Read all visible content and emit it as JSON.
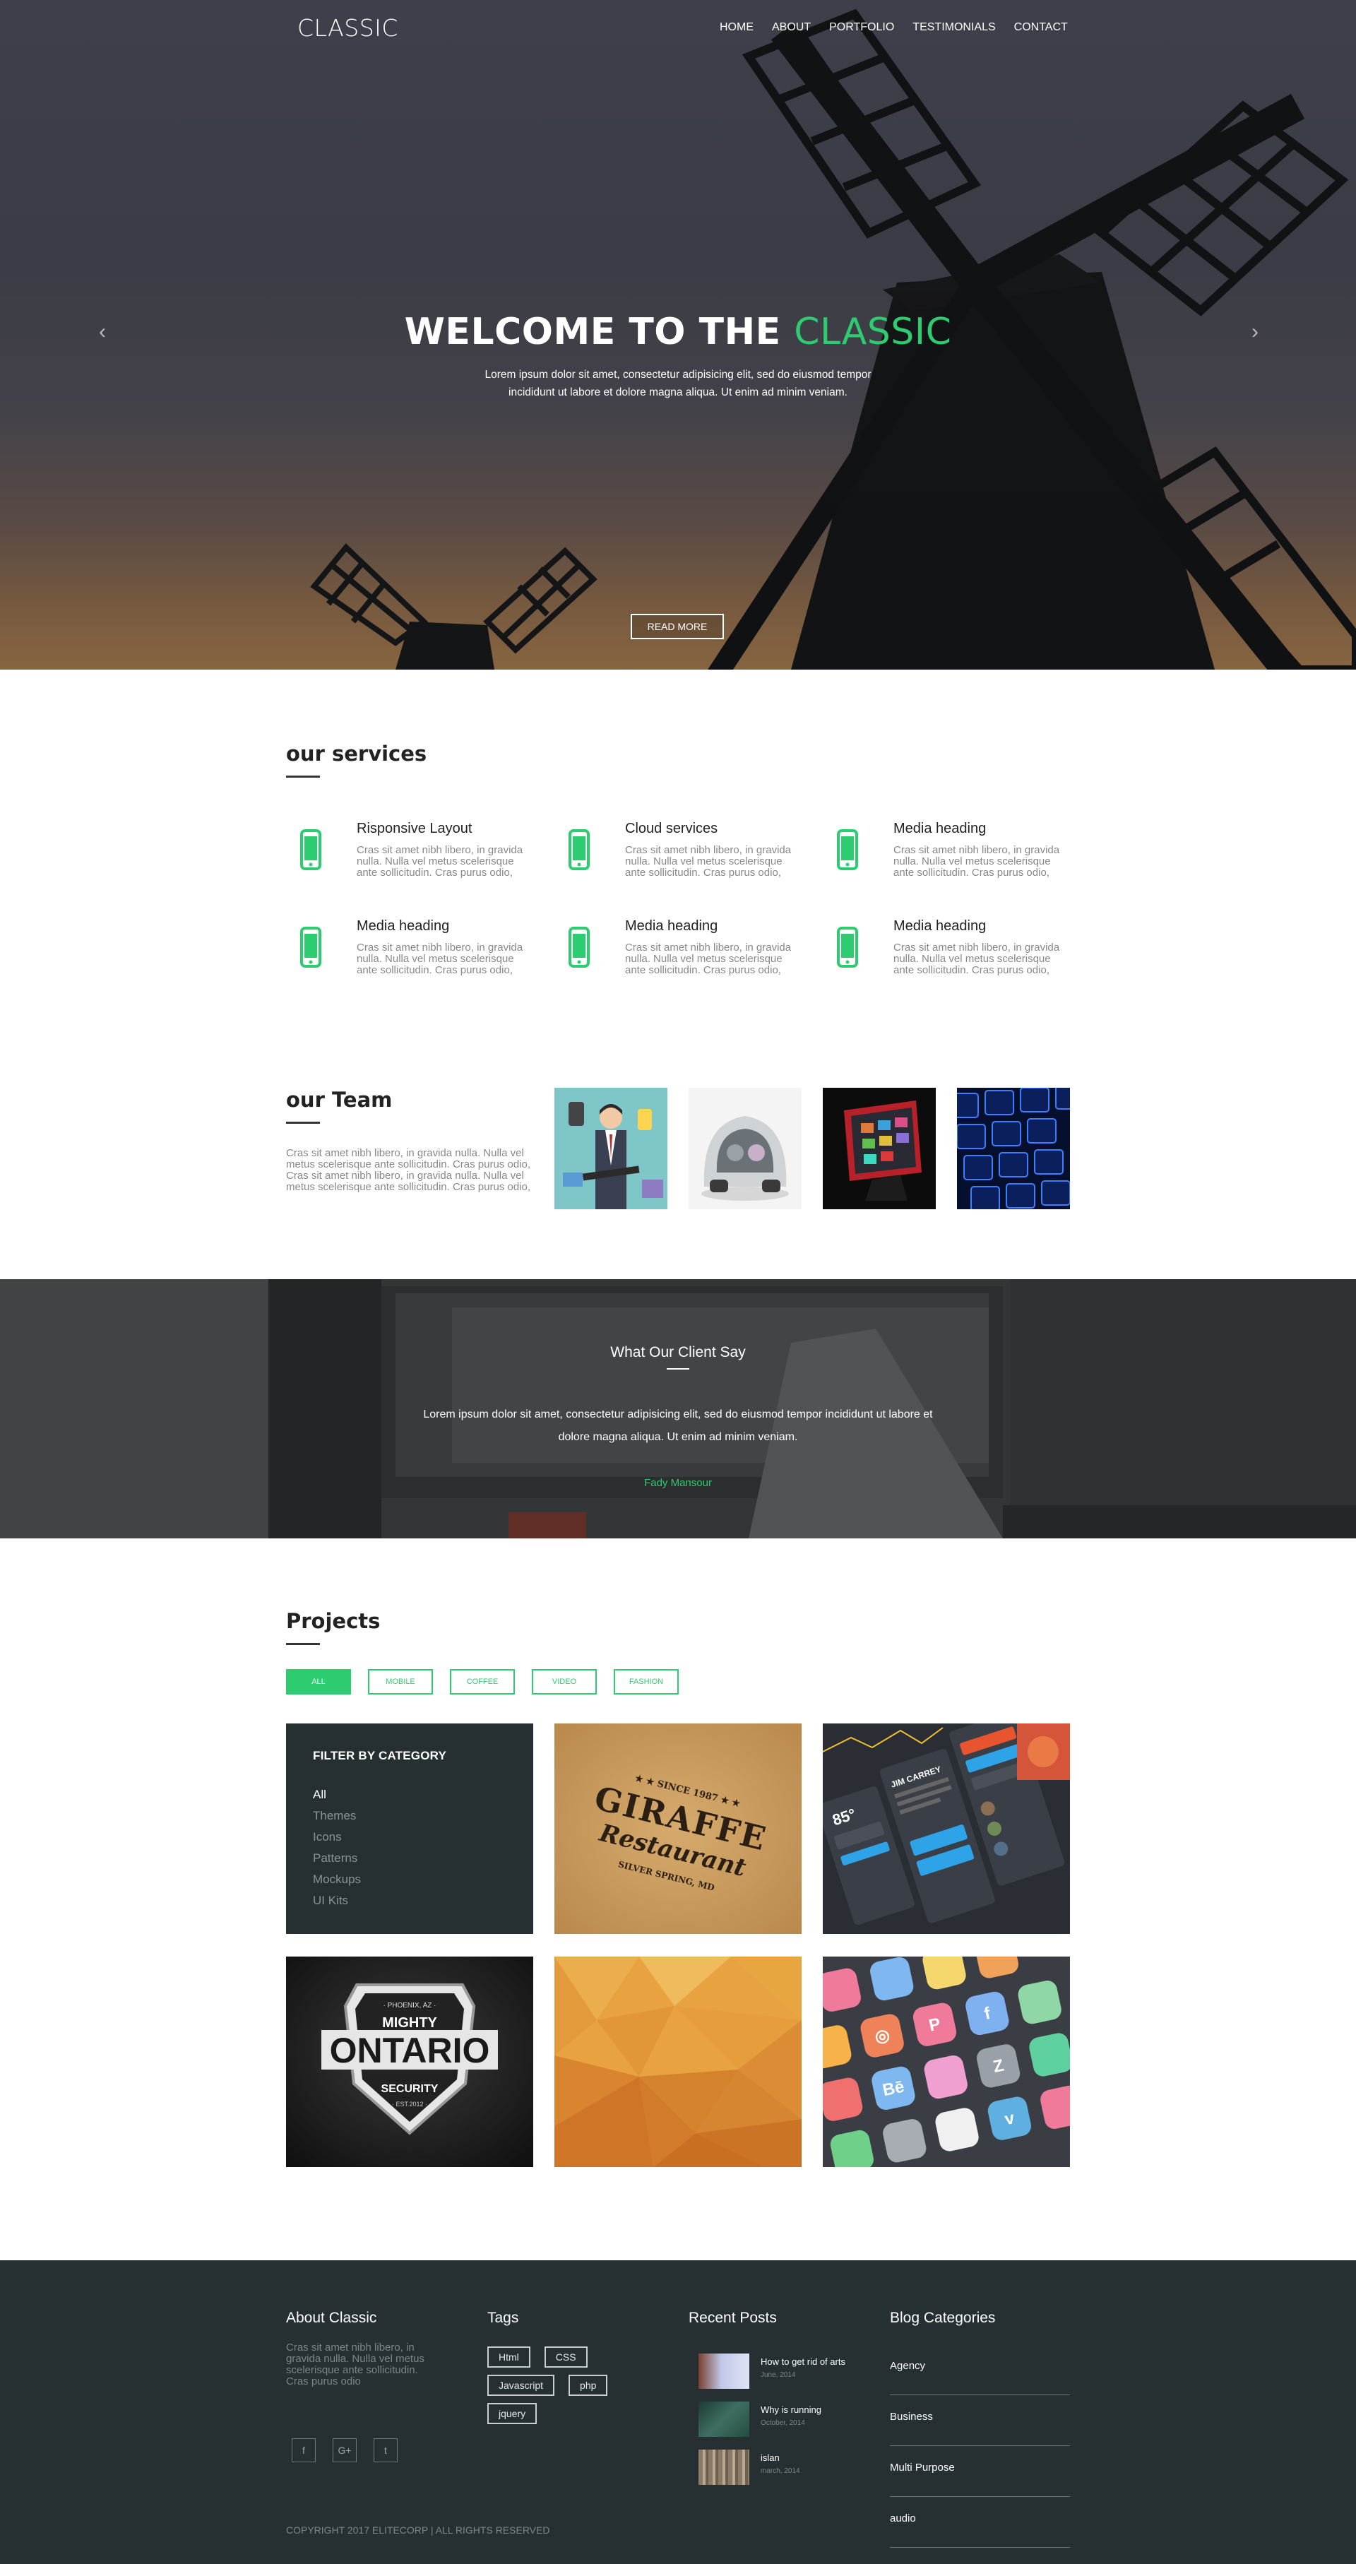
{
  "nav": {
    "logo": "CLASSIC",
    "items": [
      "HOME",
      "ABOUT",
      "PORTFOLIO",
      "TESTIMONIALS",
      "CONTACT"
    ]
  },
  "hero": {
    "title_main": "WELCOME TO THE ",
    "title_accent": "CLASSIC",
    "text": "Lorem ipsum dolor sit amet, consectetur adipisicing elit, sed do eiusmod tempor incididunt ut labore et dolore magna aliqua. Ut enim ad minim veniam.",
    "button": "READ MORE",
    "prev_icon": "chevron-left-icon",
    "next_icon": "chevron-right-icon"
  },
  "services": {
    "title": "our services",
    "items": [
      {
        "title": "Risponsive Layout",
        "text": "Cras sit amet nibh libero, in gravida nulla. Nulla vel metus scelerisque ante sollicitudin. Cras purus odio,",
        "icon": "mobile-phone-icon"
      },
      {
        "title": "Cloud services",
        "text": "Cras sit amet nibh libero, in gravida nulla. Nulla vel metus scelerisque ante sollicitudin. Cras purus odio,",
        "icon": "mobile-phone-icon"
      },
      {
        "title": "Media heading",
        "text": "Cras sit amet nibh libero, in gravida nulla. Nulla vel metus scelerisque ante sollicitudin. Cras purus odio,",
        "icon": "mobile-phone-icon"
      },
      {
        "title": "Media heading",
        "text": "Cras sit amet nibh libero, in gravida nulla. Nulla vel metus scelerisque ante sollicitudin. Cras purus odio,",
        "icon": "mobile-phone-icon"
      },
      {
        "title": "Media heading",
        "text": "Cras sit amet nibh libero, in gravida nulla. Nulla vel metus scelerisque ante sollicitudin. Cras purus odio,",
        "icon": "mobile-phone-icon"
      },
      {
        "title": "Media heading",
        "text": "Cras sit amet nibh libero, in gravida nulla. Nulla vel metus scelerisque ante sollicitudin. Cras purus odio,",
        "icon": "mobile-phone-icon"
      }
    ]
  },
  "team": {
    "title": "our Team",
    "text": "Cras sit amet nibh libero, in gravida nulla. Nulla vel metus scelerisque ante sollicitudin. Cras purus odio, Cras sit amet nibh libero, in gravida nulla. Nulla vel metus scelerisque ante sollicitudin. Cras purus odio,"
  },
  "testimonial": {
    "title": "What Our Client Say",
    "quote": "Lorem ipsum dolor sit amet, consectetur adipisicing elit, sed do eiusmod tempor incididunt ut labore et dolore magna aliqua. Ut enim ad minim veniam.",
    "author": "Fady Mansour"
  },
  "projects": {
    "title": "Projects",
    "filters": [
      "ALL",
      "MOBILE",
      "COFFEE",
      "VIDEO",
      "FASHION"
    ],
    "active_filter": "ALL",
    "category_panel_title": "FILTER BY CATEGORY",
    "categories": [
      "All",
      "Themes",
      "Icons",
      "Patterns",
      "Mockups",
      "UI Kits"
    ],
    "selected_category": "All"
  },
  "footer": {
    "about_title": "About Classic",
    "about_text": "Cras sit amet nibh libero, in gravida nulla. Nulla vel metus scelerisque ante sollicitudin. Cras purus odio",
    "social": [
      "f",
      "G+",
      "t"
    ],
    "social_icons": [
      "facebook-icon",
      "google-plus-icon",
      "twitter-icon"
    ],
    "tags_title": "Tags",
    "tags": [
      "Html",
      "CSS",
      "Javascript",
      "php",
      "jquery"
    ],
    "posts_title": "Recent Posts",
    "posts": [
      {
        "title": "How to get rid of arts",
        "date": "June, 2014"
      },
      {
        "title": "Why is running",
        "date": "October, 2014"
      },
      {
        "title": "islan",
        "date": "march, 2014"
      }
    ],
    "blog_title": "Blog Categories",
    "blog_categories": [
      "Agency",
      "Business",
      "Multi Purpose",
      "audio"
    ],
    "copyright": "COPYRIGHT 2017 ELITECORP | ALL RIGHTS RESERVED"
  },
  "colors": {
    "accent": "#2ecc71",
    "dark_panel": "#263032"
  }
}
